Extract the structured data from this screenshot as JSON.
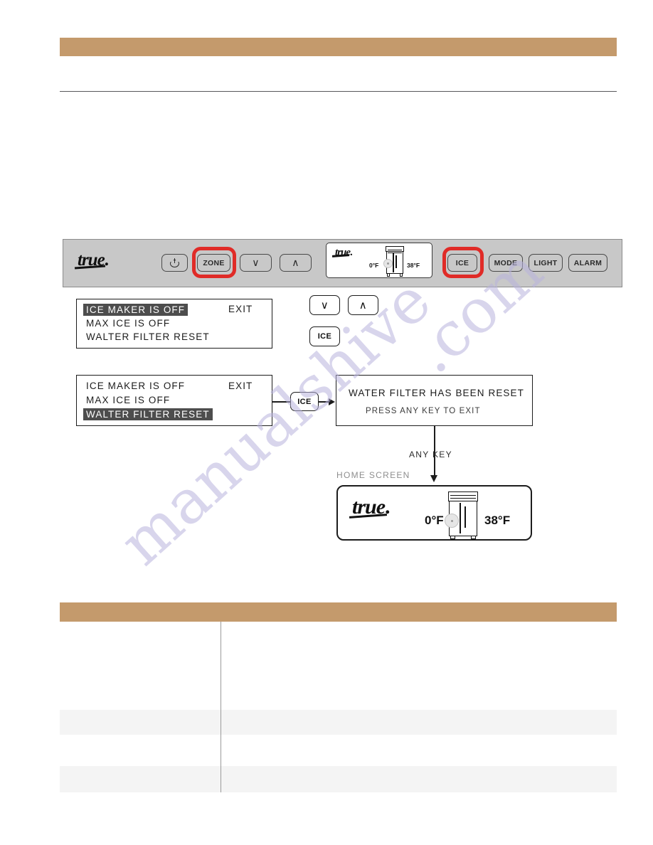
{
  "page": {
    "watermark_main": "manualshive",
    "watermark_sub": ".com",
    "accent_color": "#c49a6c",
    "highlight_color": "#e02b27"
  },
  "control_panel": {
    "brand_logo": "true",
    "logo_dot": ".",
    "keys": [
      {
        "name": "power",
        "label": "",
        "icon": "power-icon",
        "highlighted": false
      },
      {
        "name": "zone",
        "label": "ZONE",
        "icon": "",
        "highlighted": true
      },
      {
        "name": "down",
        "label": "∨",
        "icon": "chevron-down-icon",
        "highlighted": false
      },
      {
        "name": "up",
        "label": "∧",
        "icon": "chevron-up-icon",
        "highlighted": false
      },
      {
        "name": "ice",
        "label": "ICE",
        "icon": "",
        "highlighted": true
      },
      {
        "name": "mode",
        "label": "MODE",
        "icon": "",
        "highlighted": false
      },
      {
        "name": "light",
        "label": "LIGHT",
        "icon": "",
        "highlighted": false
      },
      {
        "name": "alarm",
        "label": "ALARM",
        "icon": "",
        "highlighted": false
      }
    ],
    "mini_display": {
      "logo": "true",
      "logo_dot": ".",
      "left_temp": "0°F",
      "right_temp": "38°F"
    }
  },
  "flow": {
    "screen_one": {
      "lines": [
        {
          "text": "ICE MAKER IS OFF",
          "highlighted": true
        },
        {
          "text": "MAX ICE IS OFF",
          "highlighted": false
        },
        {
          "text": "WALTER FILTER RESET",
          "highlighted": false
        }
      ],
      "exit_label": "EXIT"
    },
    "nav_keys": [
      {
        "name": "down",
        "label": "∨"
      },
      {
        "name": "up",
        "label": "∧"
      },
      {
        "name": "ice",
        "label": "ICE"
      }
    ],
    "screen_two": {
      "lines": [
        {
          "text": "ICE MAKER IS OFF",
          "highlighted": false
        },
        {
          "text": "MAX ICE IS OFF",
          "highlighted": false
        },
        {
          "text": "WALTER FILTER RESET",
          "highlighted": true
        }
      ],
      "exit_label": "EXIT"
    },
    "transition_key": {
      "name": "ice",
      "label": "ICE"
    },
    "confirm_screen": {
      "title": "WATER FILTER HAS BEEN RESET",
      "subtitle": "PRESS ANY KEY TO EXIT"
    },
    "any_key_label": "ANY KEY",
    "home_screen_label": "HOME SCREEN",
    "home_screen": {
      "logo": "true",
      "logo_dot": ".",
      "left_temp": "0°F",
      "right_temp": "38°F"
    }
  },
  "table": {
    "rows": [
      "",
      "",
      "",
      "",
      ""
    ]
  }
}
